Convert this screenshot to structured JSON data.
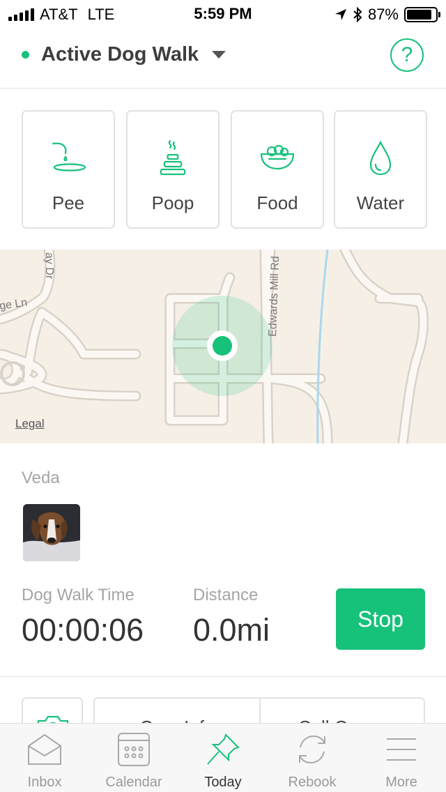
{
  "status_bar": {
    "carrier": "AT&T",
    "network": "LTE",
    "time": "5:59 PM",
    "battery_percent": "87%",
    "battery_level": 0.87,
    "icons": [
      "signal-icon",
      "location-arrow-icon",
      "bluetooth-icon",
      "battery-icon"
    ]
  },
  "header": {
    "title": "Active Dog Walk",
    "status_color": "#16c17a",
    "help_label": "?"
  },
  "actions": [
    {
      "label": "Pee",
      "icon": "pee-icon"
    },
    {
      "label": "Poop",
      "icon": "poop-icon"
    },
    {
      "label": "Food",
      "icon": "food-bowl-icon"
    },
    {
      "label": "Water",
      "icon": "water-drop-icon"
    }
  ],
  "map": {
    "street_labels": [
      "ay Dr",
      "ge Ln",
      "Edwards Mill Rd"
    ],
    "legal_label": "Legal"
  },
  "pet": {
    "name": "Veda"
  },
  "walk": {
    "time_label": "Dog Walk Time",
    "time_value": "00:00:06",
    "distance_label": "Distance",
    "distance_value": "0.0mi",
    "stop_label": "Stop"
  },
  "bottom_row": {
    "care_info": "Care Info",
    "call_owner": "Call Owner"
  },
  "tabs": [
    {
      "label": "Inbox",
      "icon": "inbox-icon",
      "active": false
    },
    {
      "label": "Calendar",
      "icon": "calendar-icon",
      "active": false
    },
    {
      "label": "Today",
      "icon": "pin-icon",
      "active": true
    },
    {
      "label": "Rebook",
      "icon": "refresh-icon",
      "active": false
    },
    {
      "label": "More",
      "icon": "menu-icon",
      "active": false
    }
  ],
  "colors": {
    "accent": "#16c17a",
    "map_background": "#f6efe6",
    "water_line": "#a8d8ee"
  }
}
